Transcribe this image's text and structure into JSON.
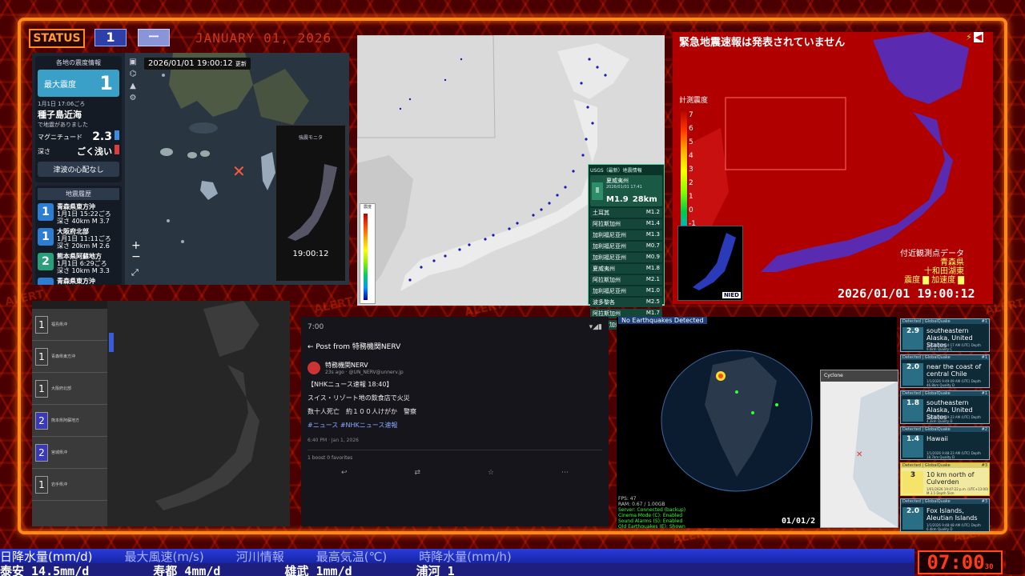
{
  "status": {
    "label": "STATUS",
    "level_1": "1",
    "level_2": "ー",
    "date_label": "JANUARY 01, 2026"
  },
  "watermark": "ALERT",
  "panel1": {
    "card_header": "各地の震度情報",
    "max_intensity_label": "最大震度",
    "max_intensity_value": "1",
    "time": "1月1日 17:06ごろ",
    "place": "種子島近海",
    "caption": "で地震がありました",
    "magnitude_label": "マグニチュード",
    "magnitude_value": "2.3",
    "depth_label": "深さ",
    "depth_value": "ごく浅い",
    "tsunami": "津波の心配なし",
    "history_header": "地震履歴",
    "history": [
      {
        "intensity": "1",
        "place": "青森県東方沖",
        "time": "1月1日 15:22ごろ",
        "depth": "深さ 40km",
        "mag": "M 3.7",
        "color": "#2d7dd2"
      },
      {
        "intensity": "1",
        "place": "大阪府北部",
        "time": "1月1日 11:11ごろ",
        "depth": "深さ 20km",
        "mag": "M 2.6",
        "color": "#2d7dd2"
      },
      {
        "intensity": "2",
        "place": "熊本県阿蘇地方",
        "time": "1月1日 6:29ごろ",
        "depth": "深さ 10km",
        "mag": "M 3.3",
        "color": "#2aa07a"
      },
      {
        "intensity": "",
        "place": "青森県東方沖",
        "time": "",
        "depth": "",
        "mag": "",
        "color": "#2d7dd2"
      }
    ],
    "map_time": "2026/01/01 19:00:12",
    "map_time_suffix": "更新",
    "zoom_in": "+",
    "zoom_out": "−",
    "phone_title": "強震モニタ",
    "phone_clock": "19:00:12"
  },
  "panel2": {
    "scale_label": "震度",
    "usgs_header": "USGS（最新）地震情報",
    "usgs_place": "夏威夷州",
    "usgs_time": "2026/01/01 17:41",
    "usgs_mag": "M1.9",
    "usgs_depth": "28km",
    "rows": [
      {
        "place": "土耳其",
        "mag": "M1.2"
      },
      {
        "place": "阿拉斯加州",
        "mag": "M1.4"
      },
      {
        "place": "加利福尼亚州",
        "mag": "M1.3"
      },
      {
        "place": "加利福尼亚州",
        "mag": "M0.7"
      },
      {
        "place": "加利福尼亚州",
        "mag": "M0.9"
      },
      {
        "place": "夏威夷州",
        "mag": "M1.8"
      },
      {
        "place": "阿拉斯加州",
        "mag": "M2.1"
      },
      {
        "place": "加利福尼亚州",
        "mag": "M1.0"
      },
      {
        "place": "波多黎各",
        "mag": "M2.5"
      },
      {
        "place": "阿拉斯加州",
        "mag": "M1.7"
      },
      {
        "place": "阿拉斯加州",
        "mag": "M2.5"
      }
    ]
  },
  "panel3": {
    "title": "緊急地震速報は発表されていません",
    "legend_label": "計測震度",
    "ticks": [
      "7",
      "6",
      "5",
      "4",
      "3",
      "2",
      "1",
      "0",
      "-1",
      "-2"
    ],
    "near_label": "付近観測点データ",
    "near_pref": "青森県",
    "near_station": "十和田湖東",
    "near_items": "震度 ▇ 加速度 ▇",
    "time": "2026/01/01 19:00:12",
    "nied": "NIED"
  },
  "panel4": {
    "items": [
      {
        "badge": "1",
        "text": "福島県沖"
      },
      {
        "badge": "1",
        "text": "青森県東方沖"
      },
      {
        "badge": "1",
        "text": "大阪府北部"
      },
      {
        "badge": "2",
        "text": "熊本県阿蘇地方"
      },
      {
        "badge": "2",
        "text": "宮城県沖"
      },
      {
        "badge": "1",
        "text": "岩手県沖"
      }
    ]
  },
  "panel5": {
    "clock": "7:00",
    "header": "Post from 特務機関NERV",
    "name": "特務機関NERV",
    "handle": "23s ago · @UN_NERV@unnerv.jp",
    "line1": "【NHKニュース速報 18:40】",
    "line2": "スイス・リゾート地の飲食店で火災",
    "line3": "数十人死亡　約１００人けがか　警察",
    "tags": "#ニュース #NHKニュース速報",
    "meta": "6:40 PM · Jan 1, 2026",
    "boost": "1 boost 0 favorites",
    "actions": [
      "↩",
      "⇄",
      "☆",
      "⋯"
    ]
  },
  "panel6": {
    "header": "No Earthquakes Detected",
    "stats": [
      "FPS: 47",
      "RAM: 0.67 / 1.00GB",
      "Server: Connected (backup)",
      "Cinema Mode (C): Enabled",
      "Sound Alarms (S): Enabled",
      "Old Earthquakes (E): Shown"
    ],
    "date": "01/01/2",
    "phone_title": "Cyclone"
  },
  "panel7": {
    "items": [
      {
        "detected": "Detected | GlobalQuake",
        "rank": "#1",
        "mag": "2.9",
        "place": "southeastern Alaska, United States",
        "detail": "1/1/2026 9:54:17 AM (UTC)  Depth 9.6km  Quality C",
        "yellow": false
      },
      {
        "detected": "Detected | GlobalQuake",
        "rank": "#1",
        "mag": "2.0",
        "place": "near the coast of central Chile",
        "detail": "1/1/2026 9:49:09 AM (UTC)  Depth 46.8km  Quality D",
        "yellow": false
      },
      {
        "detected": "Detected | GlobalQuake",
        "rank": "#1",
        "mag": "1.8",
        "place": "southeastern Alaska, United States",
        "detail": "1/1/2026 9:49:23 AM (UTC)  Depth 4.2km  Quality D",
        "yellow": false
      },
      {
        "detected": "Detected | GlobalQuake",
        "rank": "#2",
        "mag": "1.4",
        "place": "Hawaii",
        "detail": "1/1/2026 9:48:23 AM (UTC)  Depth 18.7km  Quality D",
        "yellow": false
      },
      {
        "detected": "Detected | GlobalQuake",
        "rank": "#3",
        "mag": "3",
        "place": "10 km north of Culverden",
        "detail": "1/01/2026 19:47:22 p.m. (UTC+13:00)  M 3.5  Depth 5km",
        "yellow": true
      },
      {
        "detected": "Detected | GlobalQuake",
        "rank": "#3",
        "mag": "2.0",
        "place": "Fox Islands, Aleutian Islands",
        "detail": "1/1/2026 9:48:48 AM (UTC)  Depth 6.4km  Quality D",
        "yellow": false
      }
    ]
  },
  "ticker": {
    "top": [
      "日降水量(mm/d)",
      "最大風速(m/s)",
      "河川情報",
      "最高気温(℃)",
      "時降水量(mm/h)"
    ],
    "bottom": [
      "泰安 14.5mm/d",
      "寿都 4mm/d",
      "雄武 1mm/d",
      "浦河 1"
    ],
    "clock": "07:00",
    "clock_sec": "30"
  }
}
